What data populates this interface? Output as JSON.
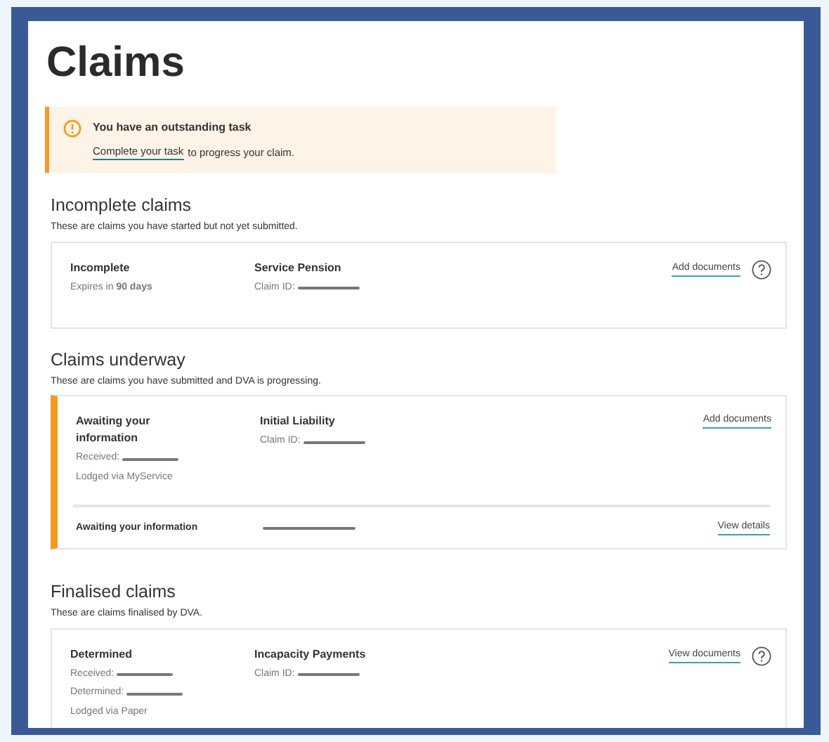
{
  "page": {
    "title": "Claims"
  },
  "alert": {
    "title": "You have an outstanding task",
    "link": "Complete your task",
    "text": "to progress your claim."
  },
  "sections": [
    {
      "heading": "Incomplete claims",
      "description": "These are claims you have started but not yet submitted.",
      "cards": [
        {
          "highlighted": false,
          "status": "Incomplete",
          "meta": [
            {
              "text": "Expires in **90 days**",
              "redacted": false
            }
          ],
          "claim_type": "Service Pension",
          "claim_id_label": "Claim ID:",
          "link": "Add documents",
          "help": true
        }
      ]
    },
    {
      "heading": "Claims underway",
      "description": "These are claims you have submitted and DVA is progressing.",
      "cards": [
        {
          "highlighted": true,
          "status": "Awaiting your information",
          "meta": [
            {
              "text": "Received:",
              "redacted": true
            },
            {
              "text": "Lodged via MyService",
              "redacted": false
            }
          ],
          "claim_type": "Initial Liability",
          "claim_id_label": "Claim ID:",
          "link": "Add documents",
          "help": false,
          "footer": {
            "label": "Awaiting your information",
            "redacted": true,
            "link": "View details"
          }
        }
      ]
    },
    {
      "heading": "Finalised claims",
      "description": "These are claims finalised by DVA.",
      "cards": [
        {
          "highlighted": false,
          "status": "Determined",
          "meta": [
            {
              "text": "Received:",
              "redacted": true
            },
            {
              "text": "Determined:",
              "redacted": true
            },
            {
              "text": "Lodged via Paper",
              "redacted": false
            }
          ],
          "claim_type": "Incapacity Payments",
          "claim_id_label": "Claim ID:",
          "link": "View documents",
          "help": true
        }
      ]
    }
  ]
}
